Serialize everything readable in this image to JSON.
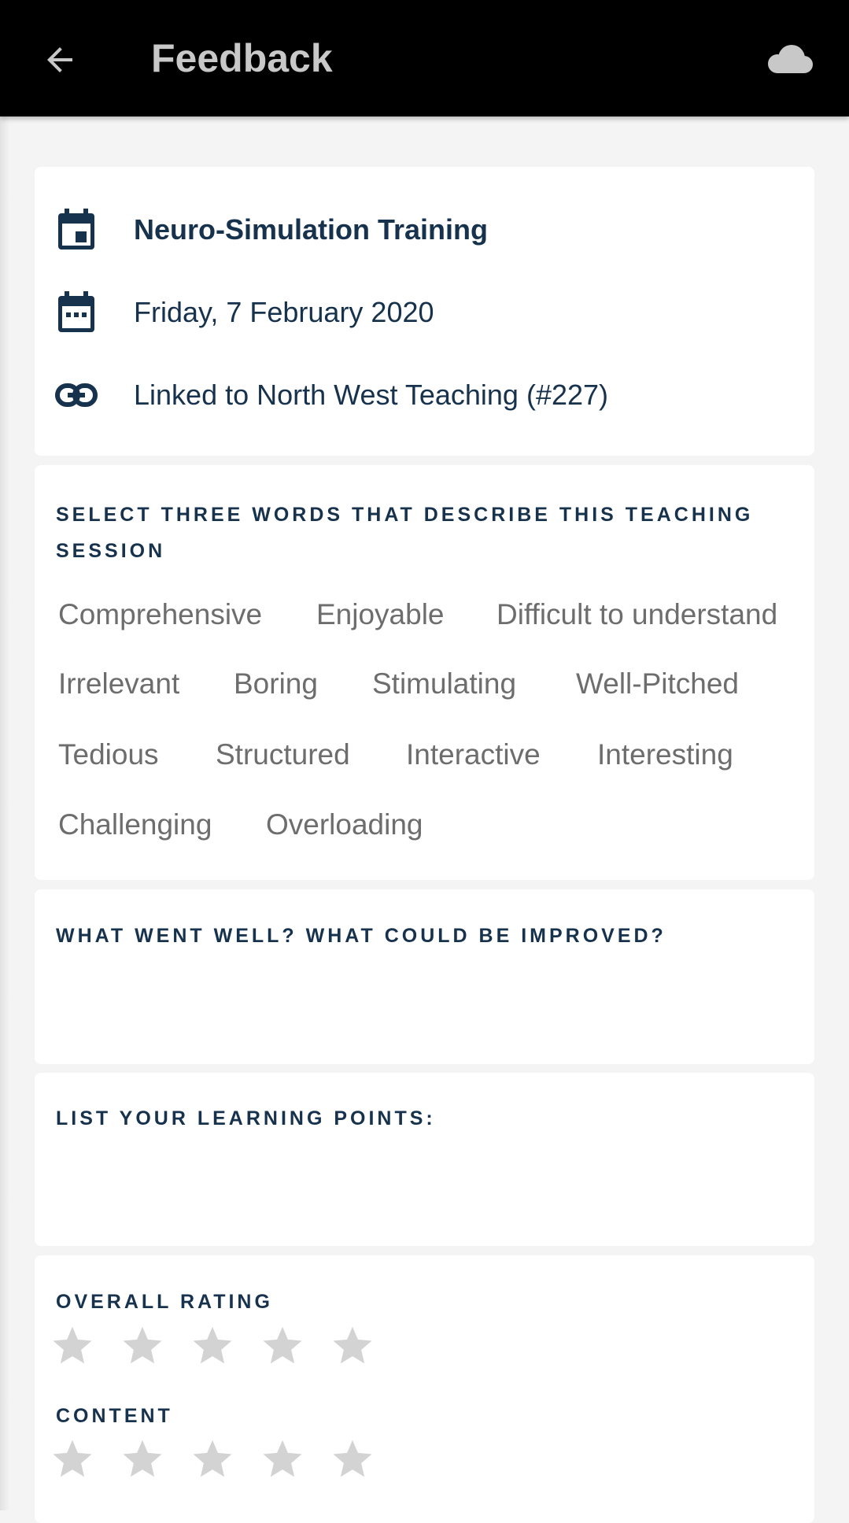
{
  "appbar": {
    "title": "Feedback",
    "back_icon": "arrow-back-icon",
    "sync_icon": "cloud-icon"
  },
  "event": {
    "name": "Neuro-Simulation Training",
    "date": "Friday, 7 February 2020",
    "link": "Linked to North West Teaching (#227)",
    "icons": [
      "event-icon",
      "calendar-icon",
      "link-icon"
    ]
  },
  "words": {
    "label": "SELECT THREE WORDS THAT DESCRIBE THIS TEACHING SESSION",
    "options": [
      "Comprehensive",
      "Enjoyable",
      "Difficult to understand",
      "Irrelevant",
      "Boring",
      "Stimulating",
      "Well-Pitched",
      "Tedious",
      "Structured",
      "Interactive",
      "Interesting",
      "Challenging",
      "Overloading"
    ]
  },
  "went_well": {
    "label": "WHAT WENT WELL? WHAT COULD BE IMPROVED?",
    "value": ""
  },
  "learning_points": {
    "label": "LIST YOUR LEARNING POINTS:",
    "value": ""
  },
  "ratings": [
    {
      "label": "OVERALL RATING",
      "max": 5,
      "value": 0
    },
    {
      "label": "CONTENT",
      "max": 5,
      "value": 0
    }
  ],
  "colors": {
    "appbar_bg": "#000000",
    "title": "#c8c8c8",
    "primary_text": "#17324d",
    "chip_text": "#6d6d6d",
    "star_empty": "#d3d3d3",
    "background": "#f4f4f4"
  }
}
